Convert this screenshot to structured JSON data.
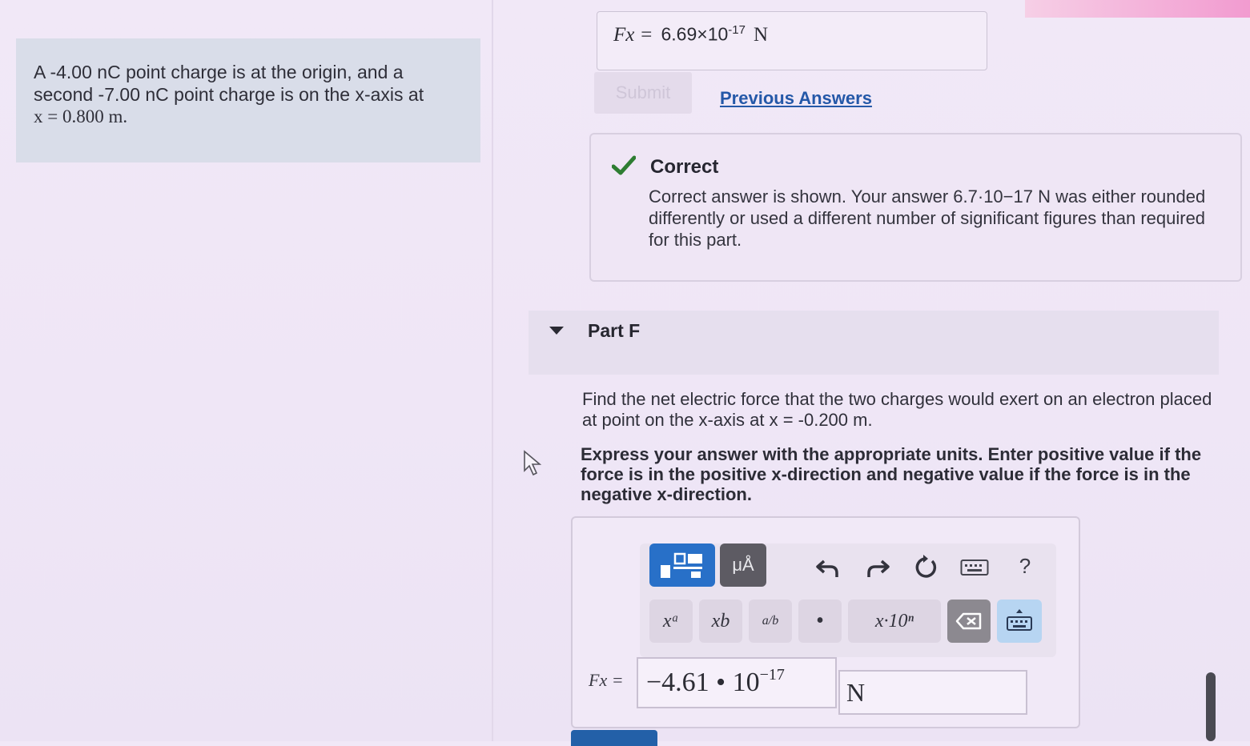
{
  "problem": {
    "line1": "A -4.00 nC point charge is at the origin, and a",
    "line2": "second -7.00 nC point charge is on the x-axis at",
    "line3": "x = 0.800 m."
  },
  "previous_answer": {
    "label": "Fx =",
    "value": "6.69×10",
    "exponent": "-17",
    "unit": "N"
  },
  "submit_label": "Submit",
  "previous_answers_label": "Previous Answers",
  "feedback": {
    "title": "Correct",
    "message": "Correct answer is shown. Your answer 6.7·10−17 N was either rounded differently or used a different number of significant figures than required for this part."
  },
  "part": {
    "title": "Part F",
    "question": "Find the net electric force that the two charges would exert on an electron placed at point on the x-axis at x = -0.200 m.",
    "instruction": "Express your answer with the appropriate units. Enter positive value if the force is in the positive x-direction and negative value if the force is in the negative x-direction."
  },
  "toolbar": {
    "symbols_label": "μÅ",
    "help_label": "?",
    "keys": {
      "superscript": "xᵃ",
      "subscript": "xb",
      "fraction": "a/b",
      "decimal": "•",
      "scientific": "x·10ⁿ"
    }
  },
  "answer": {
    "label": "Fx =",
    "value": "−4.61 • 10",
    "exponent": "−17",
    "unit": "N"
  },
  "colors": {
    "accent_blue": "#2870c8",
    "check_green": "#2e7d32",
    "link_blue": "#2458a8"
  }
}
